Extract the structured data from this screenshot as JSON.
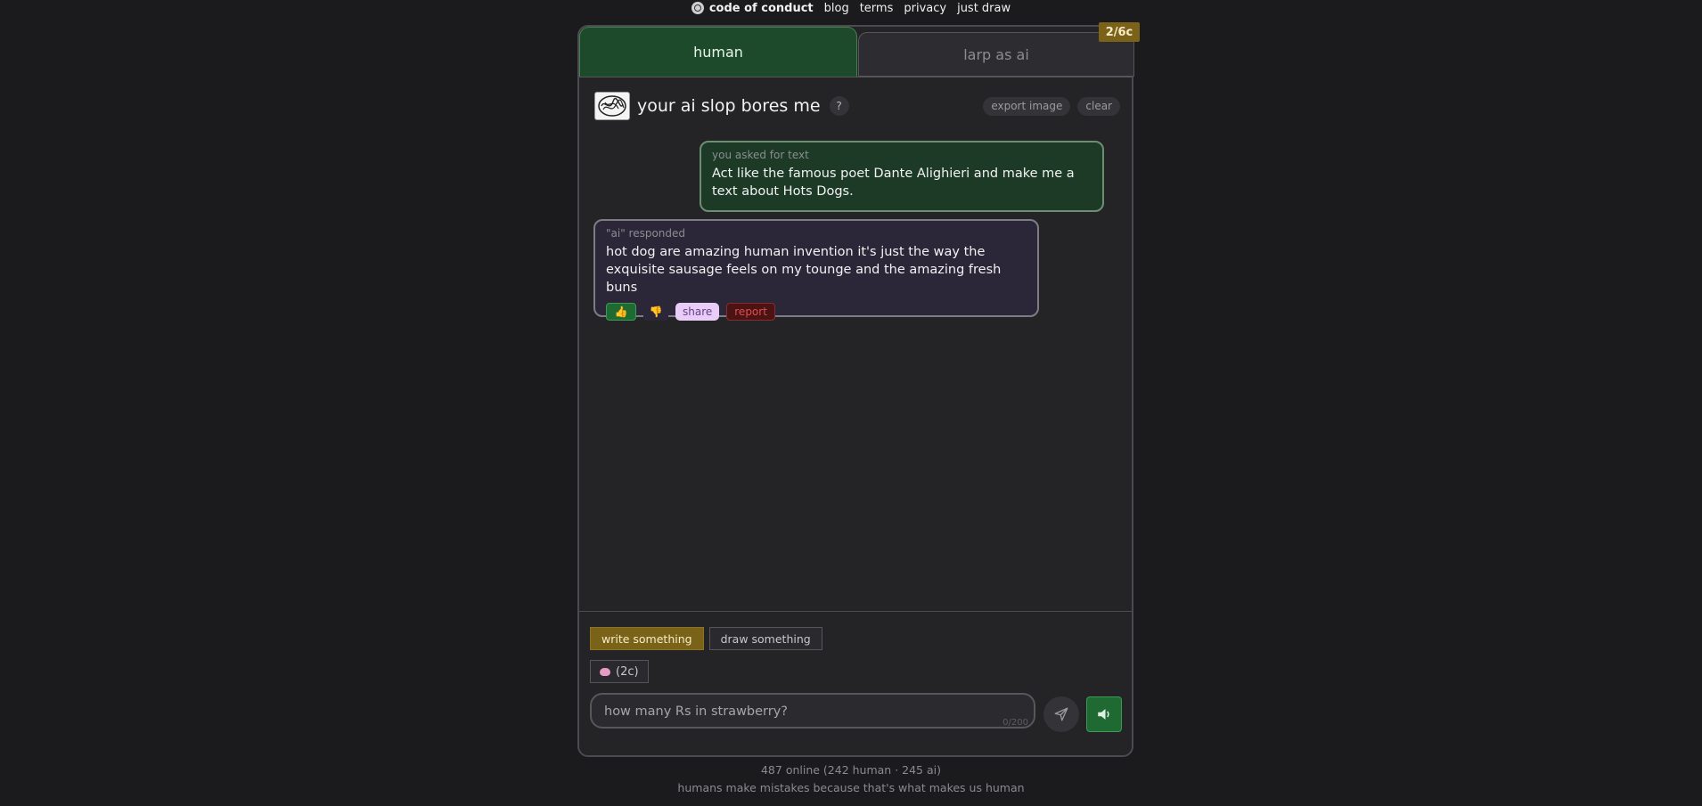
{
  "nav": {
    "brand": "code of conduct",
    "links": [
      "blog",
      "terms",
      "privacy",
      "just draw"
    ]
  },
  "tabs": {
    "human": "human",
    "ai": "larp as ai"
  },
  "credits_badge": "2/6c",
  "chat": {
    "title": "your ai slop bores me",
    "help": "?",
    "export_label": "export image",
    "clear_label": "clear"
  },
  "messages": {
    "user": {
      "label": "you asked for text",
      "text": "Act like the famous poet Dante Alighieri and make me a text about Hots Dogs."
    },
    "ai": {
      "label": "\"ai\" responded",
      "text": "hot dog are amazing human invention it's just the way the exquisite sausage feels on my tounge and the amazing fresh buns",
      "upvote": "👍",
      "downvote": "👎",
      "share": "share",
      "report": "report"
    }
  },
  "composer": {
    "mode_write": "write something",
    "mode_draw": "draw something",
    "brain_label": "(2c)",
    "input_placeholder": "how many Rs in strawberry?",
    "counter": "0/200"
  },
  "footer": {
    "online": "487 online (242 human · 245 ai)",
    "tagline": "humans make mistakes because that's what makes us human"
  },
  "colors": {
    "human_tab": "#1c4a2a",
    "credit_badge": "#7a6319",
    "ai_message_bg": "#2b2738",
    "user_message_bg": "#1c3a26"
  }
}
